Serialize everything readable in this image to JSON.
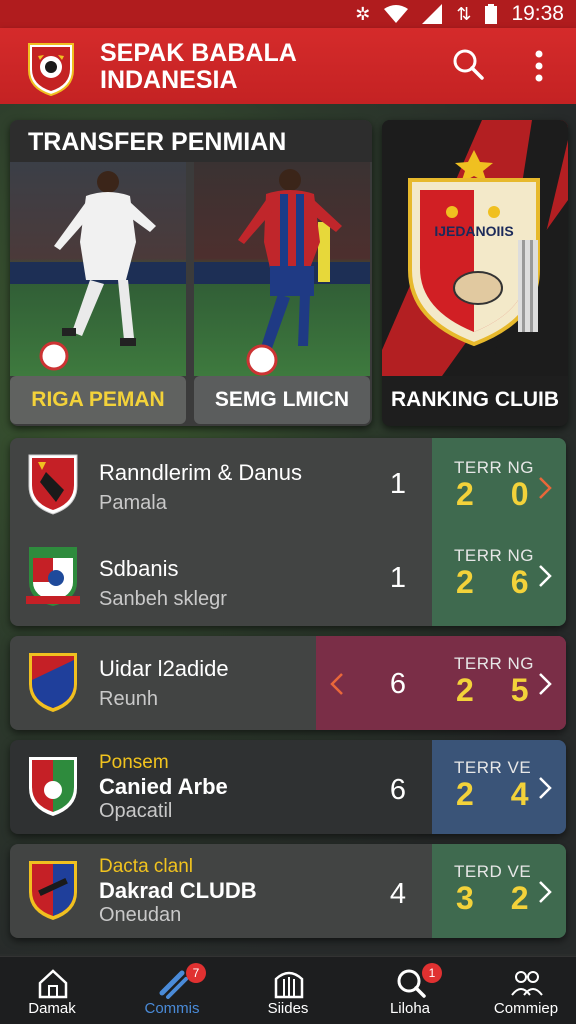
{
  "status_bar": {
    "time": "19:38"
  },
  "app_bar": {
    "title_line1": "SEPAK BABALA",
    "title_line2": "INDANESIA"
  },
  "transfer": {
    "title": "TRANSFER PENMIAN",
    "player_left_label": "RIGA PEMAN",
    "player_right_label": "SEMG LMICN"
  },
  "ranking": {
    "label": "RANKING CLUIB",
    "crest_text": "IJEDANOIIS"
  },
  "rows": [
    {
      "name": "Ranndlerim & Danus",
      "sub": "Pamala",
      "tag": "",
      "rank": "1",
      "score_label": "TERR NG",
      "score": "2 0"
    },
    {
      "name": "Sdbanis",
      "sub": "Sanbeh sklegr",
      "tag": "",
      "rank": "1",
      "score_label": "TERR NG",
      "score": "2 6"
    },
    {
      "name": "Uidar l2adide",
      "sub": "Reunh",
      "tag": "",
      "rank": "6",
      "score_label": "TERR NG",
      "score": "2 5"
    },
    {
      "name": "Canied Arbe",
      "sub": "Opacatil",
      "tag": "Ponsem",
      "rank": "6",
      "score_label": "TERR VE",
      "score": "2 4"
    },
    {
      "name": "Dakrad CLUDB",
      "sub": "Oneudan",
      "tag": "Dacta clanl",
      "rank": "4",
      "score_label": "TERD VE",
      "score": "3 2"
    }
  ],
  "bottom_nav": [
    {
      "label": "Damak",
      "badge": ""
    },
    {
      "label": "Commis",
      "badge": "7"
    },
    {
      "label": "Siides",
      "badge": ""
    },
    {
      "label": "Liloha",
      "badge": "1"
    },
    {
      "label": "Commiep",
      "badge": ""
    }
  ],
  "colors": {
    "app_bar": "#c42223",
    "accent_yellow": "#f3d23a",
    "panel_green": "#3f6a4f",
    "panel_maroon": "#7a2e47",
    "panel_blue": "#3a5478",
    "active_nav": "#4a8bd8"
  },
  "icons": {
    "search": "search-icon",
    "more": "more-vertical-icon",
    "chevron": "chevron-right-icon"
  }
}
